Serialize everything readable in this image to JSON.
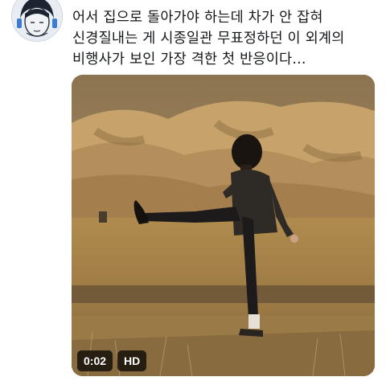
{
  "tweet": {
    "lines": [
      "어서 집으로 돌아가야 하는데 차가 안 잡혀",
      "신경질내는 게 시종일관 무표정하던 이 외계의",
      "비행사가 보인 가장 격한 첫 반응이다..."
    ]
  },
  "video": {
    "timestamp": "0:02",
    "quality": "HD"
  }
}
